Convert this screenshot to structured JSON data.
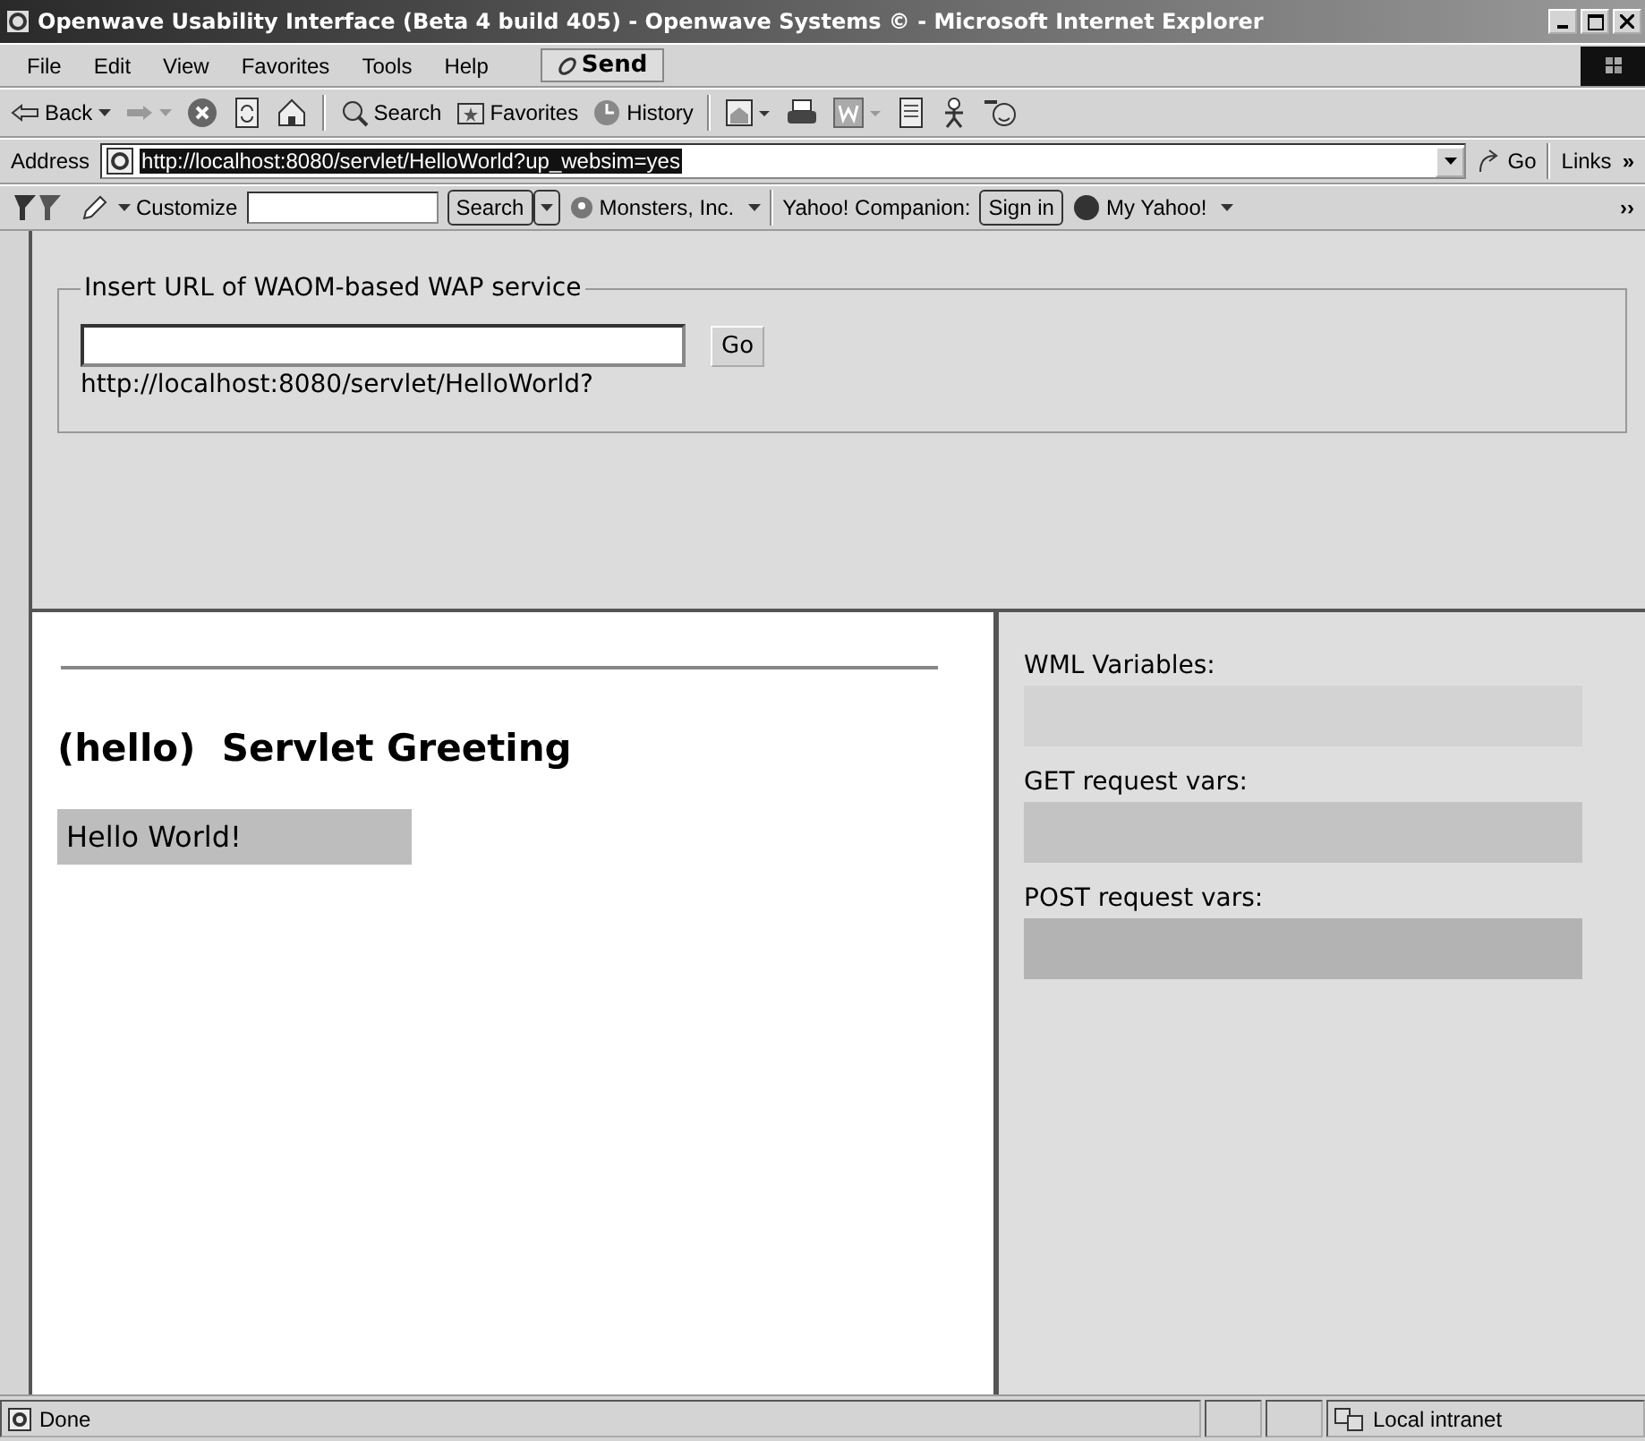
{
  "window": {
    "title": "Openwave Usability Interface (Beta 4 build 405) - Openwave Systems © - Microsoft Internet Explorer"
  },
  "menu": {
    "items": [
      "File",
      "Edit",
      "View",
      "Favorites",
      "Tools",
      "Help"
    ],
    "send": "Send"
  },
  "toolbar": [
    {
      "kind": "back",
      "label": "Back"
    },
    {
      "kind": "forward"
    },
    {
      "kind": "stop"
    },
    {
      "kind": "refresh"
    },
    {
      "kind": "home"
    },
    {
      "kind": "sep"
    },
    {
      "kind": "search",
      "label": "Search"
    },
    {
      "kind": "favorites",
      "label": "Favorites"
    },
    {
      "kind": "history",
      "label": "History"
    },
    {
      "kind": "sep"
    },
    {
      "kind": "mail"
    },
    {
      "kind": "print"
    },
    {
      "kind": "edit"
    },
    {
      "kind": "discuss"
    },
    {
      "kind": "messenger"
    },
    {
      "kind": "smiley"
    }
  ],
  "address": {
    "label": "Address",
    "value": "http://localhost:8080/servlet/HelloWorld?up_websim=yes",
    "go": "Go",
    "links": "Links",
    "more": "»"
  },
  "yahoo": {
    "customize": "Customize",
    "search": "Search",
    "monsters": "Monsters, Inc.",
    "companion": "Yahoo! Companion:",
    "sign_in": "Sign in",
    "my_yahoo": "My Yahoo!",
    "more": "››"
  },
  "url_form": {
    "legend": "Insert URL of WAOM-based WAP service",
    "button": "Go",
    "current_url": "http://localhost:8080/servlet/HelloWorld?"
  },
  "left_frame": {
    "heading": "(hello)  Servlet Greeting",
    "message": "Hello World!"
  },
  "right_frame": {
    "sections": [
      {
        "label": "WML Variables:"
      },
      {
        "label": "GET request vars:"
      },
      {
        "label": "POST request vars:"
      }
    ]
  },
  "status_bar": {
    "text": "Done",
    "zone": "Local intranet"
  }
}
